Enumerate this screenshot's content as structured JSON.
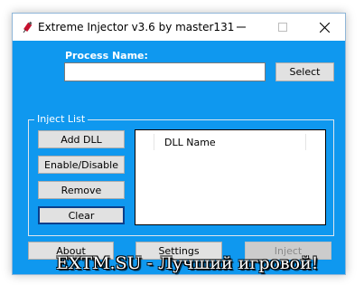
{
  "window": {
    "title": "Extreme Injector v3.6 by master131",
    "title_icon": "syringe-icon",
    "controls": [
      "minimize-icon",
      "maximize-icon",
      "close-icon"
    ]
  },
  "process": {
    "label": "Process Name:",
    "value": "",
    "select_label": "Select"
  },
  "inject_list": {
    "group_label": "Inject List",
    "buttons": {
      "add": "Add DLL",
      "enable_disable": "Enable/Disable",
      "remove": "Remove",
      "clear": "Clear"
    },
    "list": {
      "column_header": "DLL Name",
      "items": []
    }
  },
  "bottom": {
    "about": "About",
    "settings": "Settings",
    "inject": "Inject"
  },
  "watermark": "EXTM.SU - Лучший игровой!",
  "colors": {
    "client_background": "#0f98ef",
    "disabled_text": "#8a8a8a"
  }
}
